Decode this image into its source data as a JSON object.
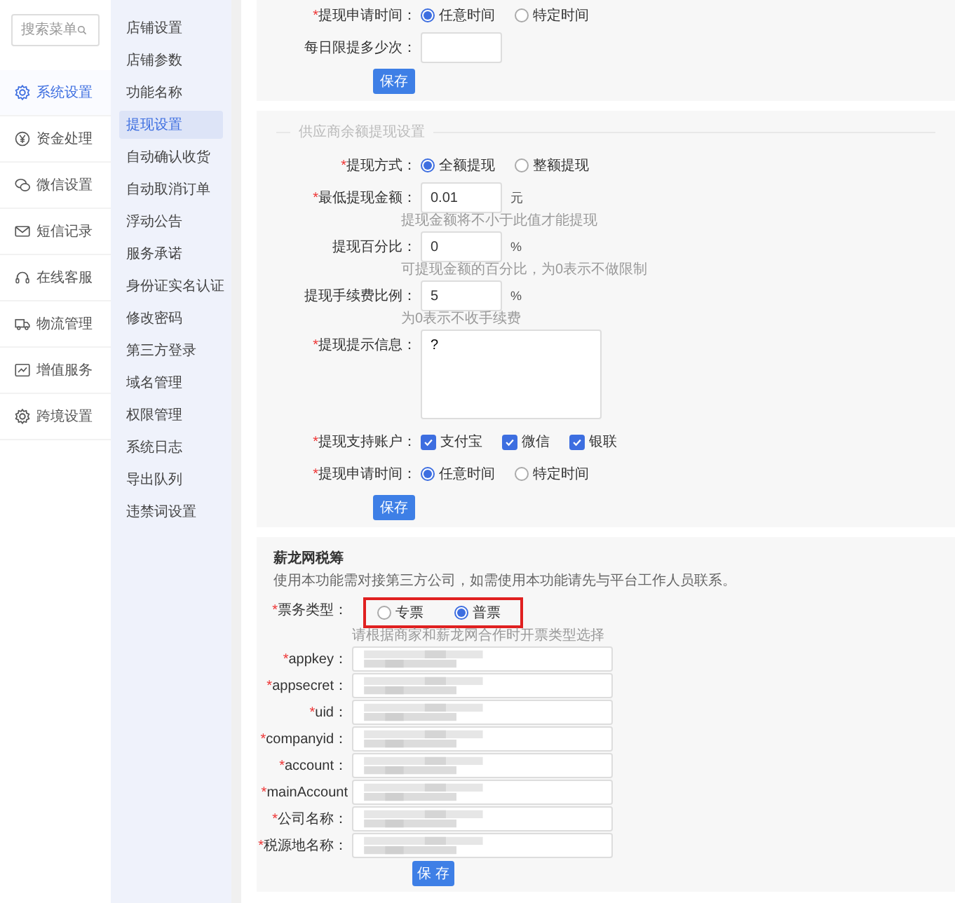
{
  "sidebar": {
    "search": {
      "placeholder": "搜索菜单"
    },
    "items": [
      {
        "label": "系统设置",
        "selected": true
      },
      {
        "label": "资金处理",
        "selected": false
      },
      {
        "label": "微信设置",
        "selected": false
      },
      {
        "label": "短信记录",
        "selected": false
      },
      {
        "label": "在线客服",
        "selected": false
      },
      {
        "label": "物流管理",
        "selected": false
      },
      {
        "label": "增值服务",
        "selected": false
      },
      {
        "label": "跨境设置",
        "selected": false
      }
    ]
  },
  "submenu": {
    "items": [
      {
        "label": "店铺设置",
        "selected": false
      },
      {
        "label": "店铺参数",
        "selected": false
      },
      {
        "label": "功能名称",
        "selected": false
      },
      {
        "label": "提现设置",
        "selected": true
      },
      {
        "label": "自动确认收货",
        "selected": false
      },
      {
        "label": "自动取消订单",
        "selected": false
      },
      {
        "label": "浮动公告",
        "selected": false
      },
      {
        "label": "服务承诺",
        "selected": false
      },
      {
        "label": "身份证实名认证",
        "selected": false
      },
      {
        "label": "修改密码",
        "selected": false
      },
      {
        "label": "第三方登录",
        "selected": false
      },
      {
        "label": "域名管理",
        "selected": false
      },
      {
        "label": "权限管理",
        "selected": false
      },
      {
        "label": "系统日志",
        "selected": false
      },
      {
        "label": "导出队列",
        "selected": false
      },
      {
        "label": "违禁词设置",
        "selected": false
      }
    ]
  },
  "sections": [
    {
      "rows": [
        {
          "kind": "radio",
          "required_mark": "*",
          "label": "提现申请时间：",
          "options": [
            {
              "label": "任意时间",
              "selected": true
            },
            {
              "label": "特定时间",
              "selected": false
            }
          ]
        },
        {
          "kind": "input",
          "label": "每日限提多少次："
        }
      ],
      "save": "保存"
    },
    {
      "legend": "供应商余额提现设置",
      "rows": [
        {
          "kind": "radio",
          "required_mark": "*",
          "label": "提现方式：",
          "options": [
            {
              "label": "全额提现",
              "selected": true
            },
            {
              "label": "整额提现",
              "selected": false
            }
          ]
        },
        {
          "kind": "input",
          "required_mark": "*",
          "label": "最低提现金额：",
          "value": "0.01",
          "unit": "元",
          "hint": "提现金额将不小于此值才能提现"
        },
        {
          "kind": "input",
          "label": "提现百分比：",
          "value": "0",
          "unit": "%",
          "hint": "可提现金额的百分比，为0表示不做限制"
        },
        {
          "kind": "input",
          "label": "提现手续费比例：",
          "value": "5",
          "unit": "%",
          "hint": "为0表示不收手续费"
        },
        {
          "kind": "textarea",
          "required_mark": "*",
          "label": "提现提示信息：",
          "value": "?"
        },
        {
          "kind": "checkbox",
          "required_mark": "*",
          "label": "提现支持账户：",
          "options": [
            {
              "label": "支付宝",
              "checked": true
            },
            {
              "label": "微信",
              "checked": true
            },
            {
              "label": "银联",
              "checked": true
            }
          ]
        },
        {
          "kind": "radio",
          "required_mark": "*",
          "label": "提现申请时间：",
          "options": [
            {
              "label": "任意时间",
              "selected": true
            },
            {
              "label": "特定时间",
              "selected": false
            }
          ]
        }
      ],
      "save": "保存"
    },
    {
      "title": "薪龙网税筹",
      "description": "使用本功能需对接第三方公司，如需使用本功能请先与平台工作人员联系。",
      "rows": [
        {
          "kind": "radio",
          "required_mark": "*",
          "label": "票务类型：",
          "highlighted": true,
          "hint": "请根据商家和薪龙网合作时开票类型选择",
          "options": [
            {
              "label": "专票",
              "selected": false
            },
            {
              "label": "普票",
              "selected": true
            }
          ]
        },
        {
          "kind": "input",
          "required_mark": "*",
          "label": "appkey：",
          "blurred": true
        },
        {
          "kind": "input",
          "required_mark": "*",
          "label": "appsecret：",
          "blurred": true
        },
        {
          "kind": "input",
          "required_mark": "*",
          "label": "uid：",
          "blurred": true
        },
        {
          "kind": "input",
          "required_mark": "*",
          "label": "companyid：",
          "blurred": true
        },
        {
          "kind": "input",
          "required_mark": "*",
          "label": "account：",
          "blurred": true
        },
        {
          "kind": "input",
          "required_mark": "*",
          "label": "mainAccount",
          "blurred": true
        },
        {
          "kind": "input",
          "required_mark": "*",
          "label": "公司名称：",
          "blurred": true
        },
        {
          "kind": "input",
          "required_mark": "*",
          "label": "税源地名称：",
          "blurred": true
        }
      ],
      "save": "保 存"
    }
  ]
}
